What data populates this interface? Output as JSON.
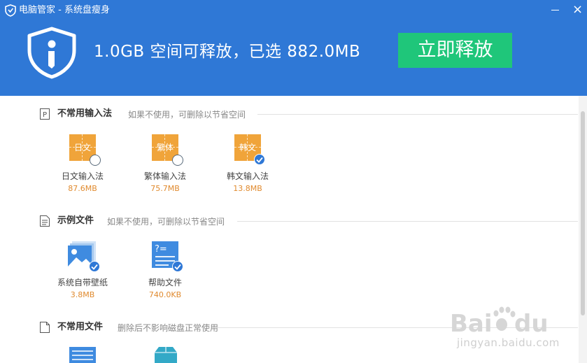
{
  "window": {
    "title": "电脑管家 - 系统盘瘦身",
    "min_icon": "minimize-icon",
    "close_icon": "close-icon",
    "close_glyph": "×"
  },
  "header": {
    "headline": "1.0GB 空间可释放，已选 882.0MB",
    "release_button": "立即释放",
    "logo_icon": "shield-i-icon"
  },
  "sections": [
    {
      "title": "不常用输入法",
      "subtitle": "如果不使用，可删除以节省空间",
      "icon": "p-box-icon",
      "items": [
        {
          "name": "日文输入法",
          "size": "87.6MB",
          "icon_label": "日文",
          "checked": false
        },
        {
          "name": "繁体输入法",
          "size": "75.7MB",
          "icon_label": "繁体",
          "checked": false
        },
        {
          "name": "韩文输入法",
          "size": "13.8MB",
          "icon_label": "韩文",
          "checked": true
        }
      ]
    },
    {
      "title": "示例文件",
      "subtitle": "如果不使用，可删除以节省空间",
      "icon": "document-icon",
      "items": [
        {
          "name": "系统自带壁纸",
          "size": "3.8MB",
          "icon": "wallpaper-icon",
          "checked": true
        },
        {
          "name": "帮助文件",
          "size": "740.0KB",
          "icon": "help-file-icon",
          "checked": true
        }
      ]
    },
    {
      "title": "不常用文件",
      "subtitle": "删除后不影响磁盘正常使用",
      "icon": "file-icon",
      "items": [
        {
          "icon": "list-file-icon"
        },
        {
          "icon": "package-icon"
        }
      ]
    }
  ],
  "watermark": {
    "url": "jingyan.baidu.com"
  },
  "colors": {
    "header_bg": "#2f78d6",
    "release_btn": "#1fc67a",
    "ime_orange": "#f0a43a",
    "size_orange": "#e08a2e"
  }
}
